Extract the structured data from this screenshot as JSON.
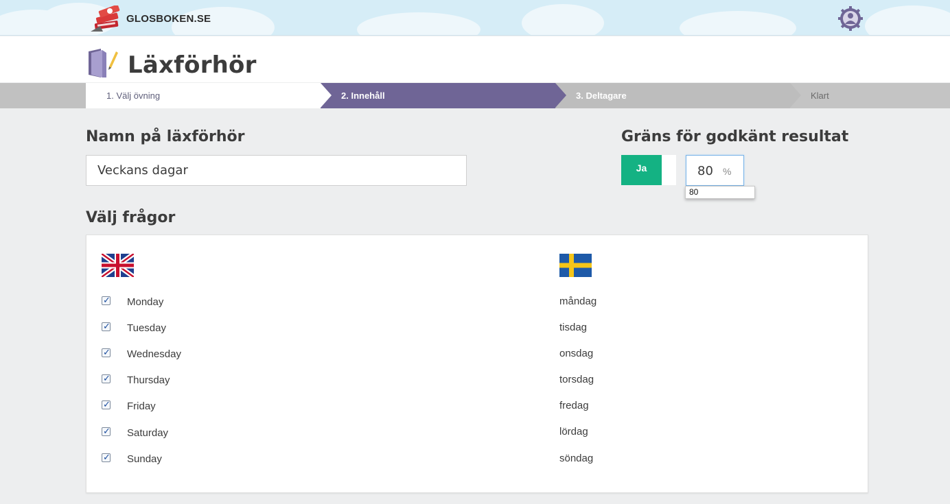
{
  "header": {
    "logo_text": "GLOSBOKEN.SE",
    "user_icon": "user-gear-icon"
  },
  "page": {
    "title": "Läxförhör",
    "title_icon": "book-pencil-icon"
  },
  "steps": [
    {
      "label": "1. Välj övning",
      "state": "done"
    },
    {
      "label": "2. Innehåll",
      "state": "active"
    },
    {
      "label": "3. Deltagare",
      "state": "upcoming"
    },
    {
      "label": "Klart",
      "state": "upcoming"
    }
  ],
  "name_section": {
    "heading": "Namn på läxförhör",
    "value": "Veckans dagar"
  },
  "pass_section": {
    "heading": "Gräns för godkänt resultat",
    "toggle_label": "Ja",
    "value": "80",
    "unit": "%",
    "autocomplete": "80"
  },
  "questions": {
    "heading": "Välj frågor",
    "source_flag": "uk-flag",
    "target_flag": "sweden-flag",
    "rows": [
      {
        "en": "Monday",
        "sv": "måndag",
        "checked": true
      },
      {
        "en": "Tuesday",
        "sv": "tisdag",
        "checked": true
      },
      {
        "en": "Wednesday",
        "sv": "onsdag",
        "checked": true
      },
      {
        "en": "Thursday",
        "sv": "torsdag",
        "checked": true
      },
      {
        "en": "Friday",
        "sv": "fredag",
        "checked": true
      },
      {
        "en": "Saturday",
        "sv": "lördag",
        "checked": true
      },
      {
        "en": "Sunday",
        "sv": "söndag",
        "checked": true
      }
    ]
  },
  "colors": {
    "active_step": "#6f6596",
    "toggle_on": "#14b283",
    "sky": "#d6edf7"
  }
}
